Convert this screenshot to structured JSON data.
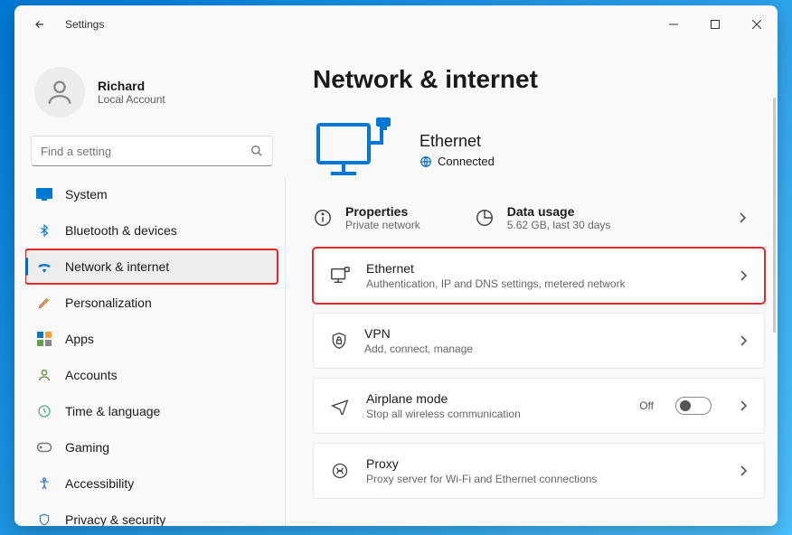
{
  "window": {
    "title": "Settings"
  },
  "profile": {
    "name": "Richard",
    "type": "Local Account"
  },
  "search": {
    "placeholder": "Find a setting"
  },
  "nav": [
    {
      "label": "System"
    },
    {
      "label": "Bluetooth & devices"
    },
    {
      "label": "Network & internet"
    },
    {
      "label": "Personalization"
    },
    {
      "label": "Apps"
    },
    {
      "label": "Accounts"
    },
    {
      "label": "Time & language"
    },
    {
      "label": "Gaming"
    },
    {
      "label": "Accessibility"
    },
    {
      "label": "Privacy & security"
    }
  ],
  "page": {
    "title": "Network & internet",
    "status": {
      "name": "Ethernet",
      "state": "Connected"
    },
    "properties": {
      "title": "Properties",
      "sub": "Private network"
    },
    "datausage": {
      "title": "Data usage",
      "sub": "5.62 GB, last 30 days"
    },
    "cards": {
      "ethernet": {
        "title": "Ethernet",
        "sub": "Authentication, IP and DNS settings, metered network"
      },
      "vpn": {
        "title": "VPN",
        "sub": "Add, connect, manage"
      },
      "airplane": {
        "title": "Airplane mode",
        "sub": "Stop all wireless communication",
        "toggle": "Off"
      },
      "proxy": {
        "title": "Proxy",
        "sub": "Proxy server for Wi-Fi and Ethernet connections"
      }
    }
  }
}
